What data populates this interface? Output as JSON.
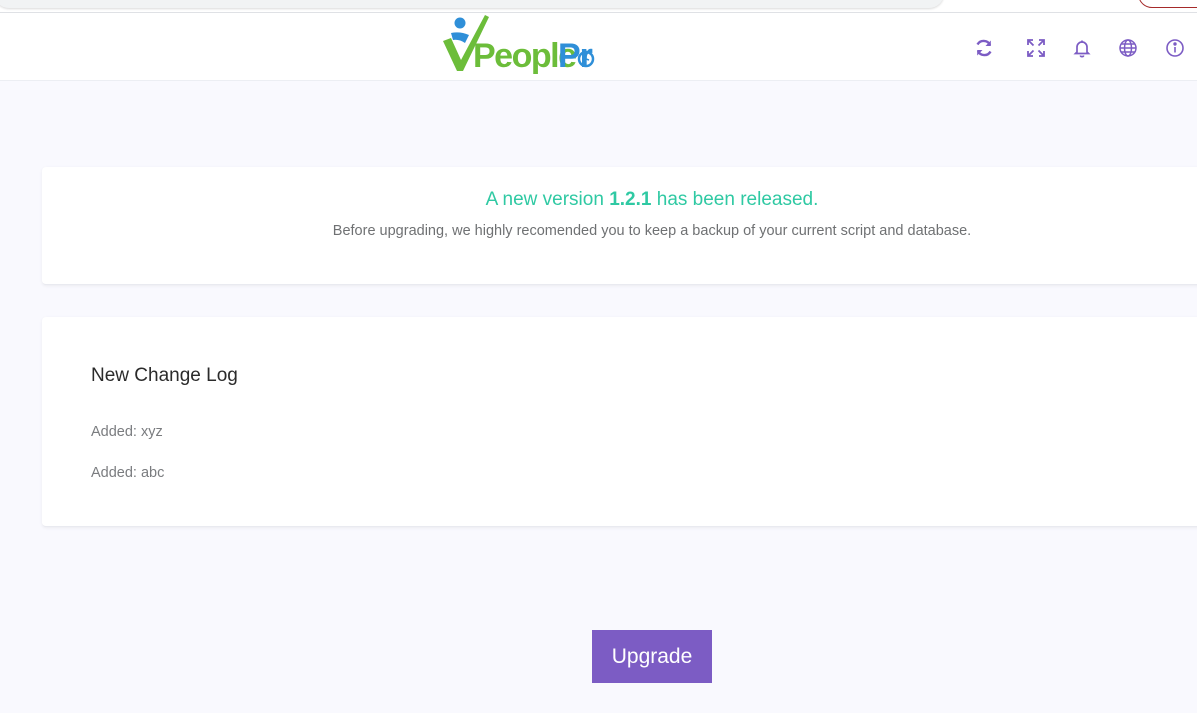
{
  "header": {
    "logo_text": "PeoplePro",
    "icons": [
      "refresh-icon",
      "fullscreen-icon",
      "bell-icon",
      "globe-icon",
      "info-icon"
    ],
    "icon_color": "#7c5cc4"
  },
  "release": {
    "prefix": "A new version ",
    "version": "1.2.1",
    "suffix": " has been released.",
    "note": "Before upgrading, we highly recomended you to keep a backup of your current script and database.",
    "accent_color": "#2fc9a3"
  },
  "changelog": {
    "title": "New Change Log",
    "items": [
      "Added: xyz",
      "Added: abc"
    ]
  },
  "actions": {
    "upgrade_label": "Upgrade",
    "button_color": "#7c5cc4"
  }
}
